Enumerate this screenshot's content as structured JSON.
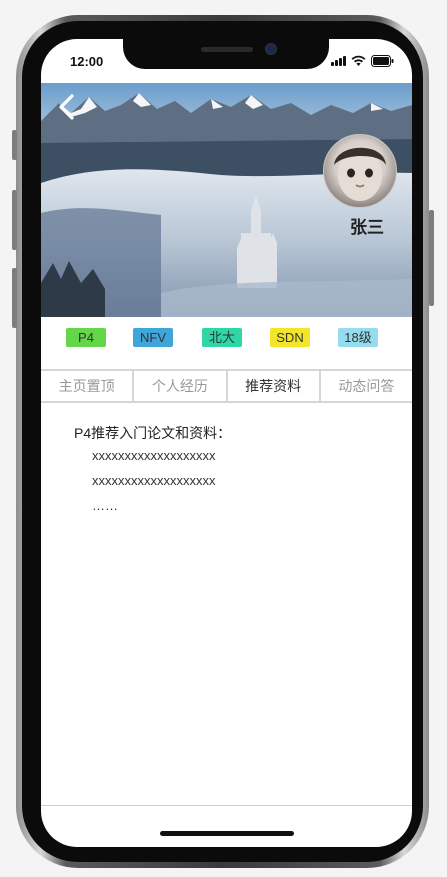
{
  "status_bar": {
    "time": "12:00"
  },
  "profile": {
    "name": "张三"
  },
  "tags": [
    {
      "label": "P4",
      "color": "#63d64a"
    },
    {
      "label": "NFV",
      "color": "#3ea6d8"
    },
    {
      "label": "北大",
      "color": "#2fd6a6"
    },
    {
      "label": "SDN",
      "color": "#f2e52a"
    },
    {
      "label": "18级",
      "color": "#95dcee"
    }
  ],
  "tabs": [
    {
      "label": "主页置顶",
      "active": false
    },
    {
      "label": "个人经历",
      "active": false
    },
    {
      "label": "推荐资料",
      "active": true
    },
    {
      "label": "动态问答",
      "active": false
    }
  ],
  "content": {
    "title": "P4推荐入门论文和资料：",
    "lines": [
      "xxxxxxxxxxxxxxxxxxx",
      "xxxxxxxxxxxxxxxxxxx",
      "……"
    ]
  },
  "icons": {
    "back": "chevron-left-icon",
    "signal": "cellular-signal-icon",
    "wifi": "wifi-icon",
    "battery": "battery-icon"
  }
}
